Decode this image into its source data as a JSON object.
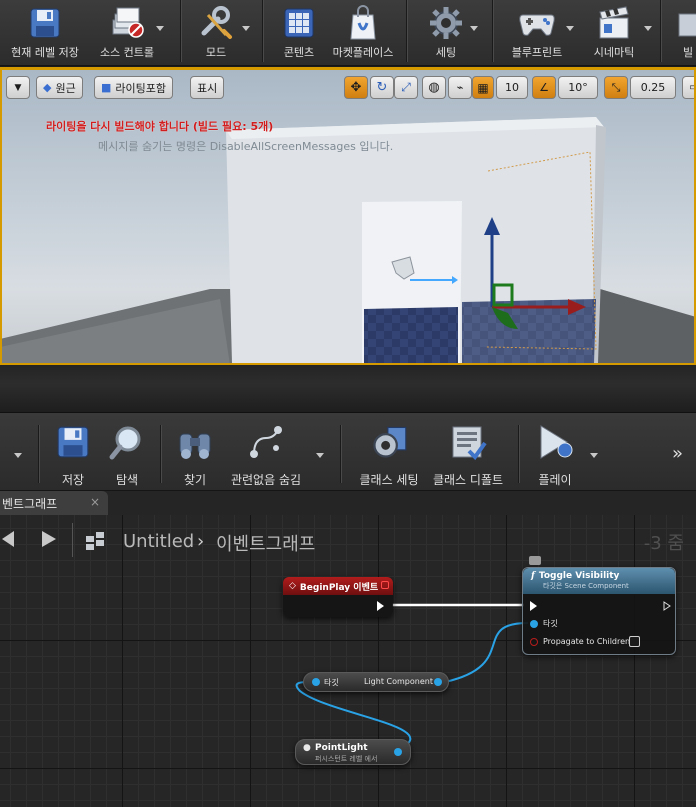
{
  "top_toolbar": {
    "items": [
      {
        "label": "현재 레벨 저장",
        "icon": "save-icon"
      },
      {
        "label": "소스 컨트롤",
        "icon": "source-control-icon"
      },
      {
        "label": "모드",
        "icon": "modes-icon"
      },
      {
        "label": "콘텐츠",
        "icon": "content-icon"
      },
      {
        "label": "마켓플레이스",
        "icon": "marketplace-icon"
      },
      {
        "label": "세팅",
        "icon": "settings-icon"
      },
      {
        "label": "블루프린트",
        "icon": "blueprints-icon"
      },
      {
        "label": "시네마틱",
        "icon": "cinematics-icon"
      },
      {
        "label": "빌",
        "icon": "build-icon"
      }
    ]
  },
  "viewport": {
    "perspective": "원근",
    "lighting": "라이팅포함",
    "show": "표시",
    "grid_snap": "10",
    "rotation_snap": "10°",
    "scale_snap": "0.25",
    "warning": "라이팅을 다시 빌드해야 합니다 (빌드 필요: 5개)",
    "hint": "메시지를 숨기는 명령은 DisableAllScreenMessages 입니다."
  },
  "blueprint_toolbar": {
    "items": [
      {
        "label": "저장",
        "icon": "save-icon"
      },
      {
        "label": "탐색",
        "icon": "browse-icon"
      },
      {
        "label": "찾기",
        "icon": "find-icon"
      },
      {
        "label": "관련없음 숨김",
        "icon": "hide-unrelated-icon"
      },
      {
        "label": "클래스 세팅",
        "icon": "class-settings-icon"
      },
      {
        "label": "클래스 디폴트",
        "icon": "class-defaults-icon"
      },
      {
        "label": "플레이",
        "icon": "play-icon"
      }
    ]
  },
  "graph_tab": {
    "label": "벤트그래프",
    "close": "×"
  },
  "graph": {
    "breadcrumb_root": "Untitled",
    "breadcrumb_sep": "›",
    "breadcrumb_current": "이벤트그래프",
    "zoom": "-3 줌"
  },
  "nodes": {
    "begin_play": {
      "title": "BeginPlay 이벤트"
    },
    "toggle_visibility": {
      "title": "Toggle Visibility",
      "subtitle": "타깃은 Scene Component",
      "target_pin": "타깃",
      "propagate_pin": "Propagate to Children"
    },
    "light_component": {
      "target_pin": "타깃",
      "output": "Light Component"
    },
    "point_light": {
      "title": "PointLight",
      "subtitle": "퍼시스턴트 레벨 에서"
    }
  },
  "colors": {
    "accent_orange": "#d49a00",
    "warning_red": "#d11d1d",
    "event_node_red": "#8b1414",
    "function_node_blue": "#3a6e8e",
    "object_pin_blue": "#2aa2e6"
  }
}
